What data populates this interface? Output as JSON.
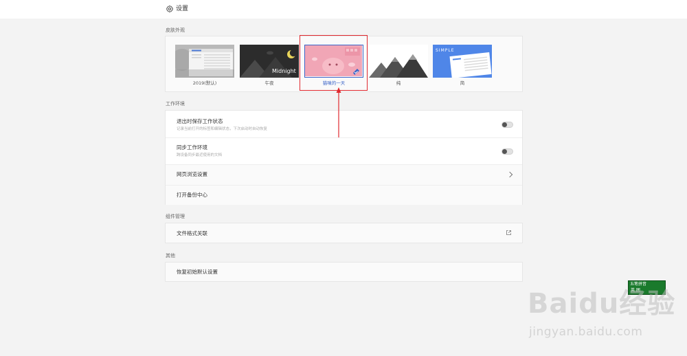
{
  "header": {
    "title": "设置",
    "icon": "gear-icon"
  },
  "sections": {
    "skins_label": "皮肤外观",
    "workspace_label": "工作环境",
    "components_label": "组件管理",
    "other_label": "其他"
  },
  "skins": [
    {
      "label": "2019(默认)",
      "selected": false
    },
    {
      "label": "午夜",
      "selected": false,
      "thumb_text": "Midnight"
    },
    {
      "label": "猫咪的一天",
      "selected": true
    },
    {
      "label": "纯",
      "selected": false
    },
    {
      "label": "简",
      "selected": false,
      "thumb_text": "SIMPLE"
    }
  ],
  "workspace": {
    "save_on_exit": {
      "title": "退出时保存工作状态",
      "desc": "记录当前打开的标签和编辑状态，下次启动时自动恢复",
      "enabled": false
    },
    "sync": {
      "title": "同步工作环境",
      "desc": "跨设备同步最近使用的文档",
      "enabled": false
    },
    "browser_settings": {
      "title": "网页浏览设置"
    },
    "backup_center": {
      "title": "打开备份中心"
    }
  },
  "components": {
    "file_assoc": {
      "title": "文件格式关联"
    }
  },
  "other": {
    "restore_defaults": {
      "title": "恢复初始默认设置"
    }
  },
  "ime": {
    "line1": "五笔拼音",
    "line2": "英 囲"
  },
  "watermark": {
    "logo": "Baidu经验",
    "url": "jingyan.baidu.com"
  },
  "colors": {
    "accent": "#3a64c8",
    "highlight": "#e0282e",
    "ime_bg": "#1a7a2c"
  }
}
